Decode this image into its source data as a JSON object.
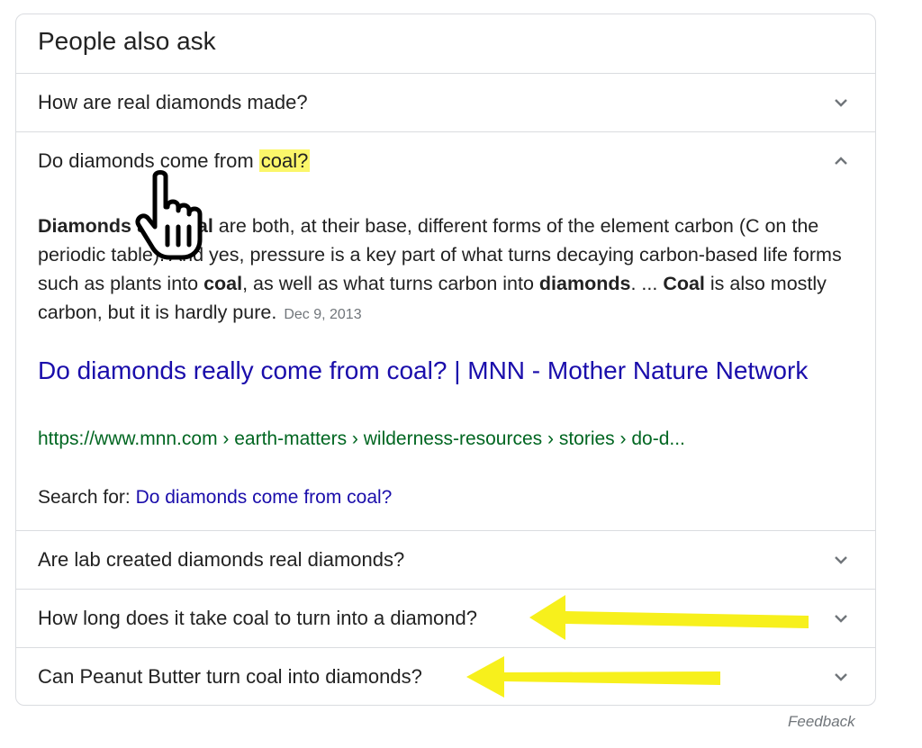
{
  "panel": {
    "title": "People also ask",
    "questions": [
      {
        "text": "How are real diamonds made?",
        "expanded": false
      },
      {
        "text_before": "Do diamonds come from ",
        "highlight": "coal?",
        "expanded": true
      },
      {
        "text": "Are lab created diamonds real diamonds?",
        "expanded": false
      },
      {
        "text": "How long does it take coal to turn into a diamond?",
        "expanded": false
      },
      {
        "text": "Can Peanut Butter turn coal into diamonds?",
        "expanded": false
      }
    ],
    "answer": {
      "b1": "Diamonds",
      "t1": " and ",
      "b2": "coal",
      "t2": " are both, at their base, different forms of the element carbon (C on the periodic table). And yes, pressure is a key part of what turns decaying carbon-based life forms such as plants into ",
      "b3": "coal",
      "t3": ", as well as what turns carbon into ",
      "b4": "diamonds",
      "t4": ". ... ",
      "b5": "Coal",
      "t5": " is also mostly carbon, but it is hardly pure.",
      "date": "Dec 9, 2013"
    },
    "result": {
      "title": "Do diamonds really come from coal? | MNN - Mother Nature Network",
      "url": "https://www.mnn.com › earth-matters › wilderness-resources › stories › do-d..."
    },
    "search_for": {
      "label": "Search for: ",
      "query": "Do diamonds come from coal?"
    }
  },
  "feedback_label": "Feedback",
  "colors": {
    "highlight": "#fbf66a",
    "link": "#1a0dab",
    "url": "#006621",
    "arrow": "#f7f01c"
  },
  "icons": [
    "chevron-down-icon",
    "chevron-up-icon",
    "hand-pointer-icon",
    "arrow-left-icon"
  ]
}
